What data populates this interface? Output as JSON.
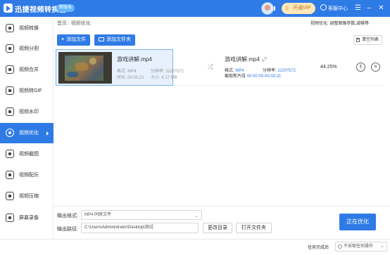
{
  "titlebar": {
    "app_title": "迅捷视频转换器",
    "badge": "新版本",
    "vip_label": "开通VIP",
    "service_label": "客服中心",
    "menu_icon": "menu-icon",
    "minimize_icon": "minimize-icon",
    "close_icon": "close-icon"
  },
  "sidebar": {
    "items": [
      {
        "label": "视频转换",
        "icon": "convert-icon"
      },
      {
        "label": "视频分割",
        "icon": "split-icon"
      },
      {
        "label": "视频合并",
        "icon": "merge-icon"
      },
      {
        "label": "视频转GIF",
        "icon": "gif-icon"
      },
      {
        "label": "视频水印",
        "icon": "watermark-icon"
      },
      {
        "label": "视频优化",
        "icon": "optimize-icon",
        "active": true
      },
      {
        "label": "视频截图",
        "icon": "screenshot-icon"
      },
      {
        "label": "视频配乐",
        "icon": "music-icon"
      },
      {
        "label": "视频压缩",
        "icon": "compress-icon"
      },
      {
        "label": "屏幕录像",
        "icon": "record-icon"
      }
    ]
  },
  "header": {
    "breadcrumb": "首页 : 视频优化",
    "opt_hint": "视频优化: 调整图像参数,减噪等"
  },
  "toolbar": {
    "add_file": "添加文件",
    "add_folder": "添加文件夹",
    "clear_list": "清空列表"
  },
  "file": {
    "source_name": "游戏讲解.mp4",
    "format_label": "格式:",
    "format": "MP4",
    "resolution_label": "分辨率:",
    "resolution": "1220*572",
    "duration_label": "时长:",
    "duration": "00:00:21",
    "size_label": "大小:",
    "size": "4.17 MB",
    "output_name": "游戏讲解.mp4",
    "output_format_label": "格式:",
    "output_format": "MP4",
    "output_resolution_label": "分辨率:",
    "output_resolution": "1220*572",
    "clip_label": "截取新片段",
    "clip_range": "00:00:00-00:00:21",
    "progress": "44.25%"
  },
  "bottom": {
    "output_format_label": "输出格式:",
    "output_format_value": "MP4  同原文件",
    "output_path_label": "输出路径:",
    "output_path_value": "C:\\Users\\Administrator\\Desktop\\测试",
    "change_dir": "更改目录",
    "open_folder": "打开文件夹",
    "optimize_btn": "正在优化"
  },
  "status": {
    "after_label": "任务完成后",
    "after_value": "不采取任何操作"
  },
  "colors": {
    "primary": "#2f7be5",
    "vip_bg": "#ffe7b8",
    "vip_text": "#b8741a"
  }
}
